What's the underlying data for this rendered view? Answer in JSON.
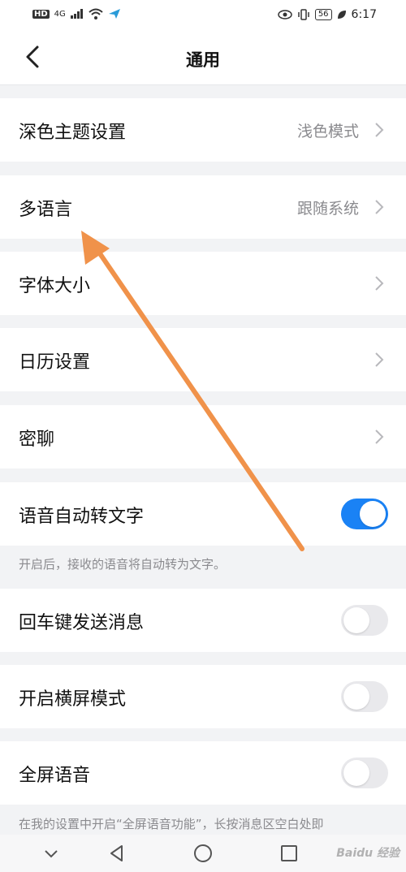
{
  "status_bar": {
    "left_badge": "HD",
    "network": "4G",
    "battery": "56",
    "time": "6:17"
  },
  "header": {
    "title": "通用"
  },
  "settings": {
    "dark_theme": {
      "label": "深色主题设置",
      "value": "浅色模式"
    },
    "language": {
      "label": "多语言",
      "value": "跟随系统"
    },
    "font_size": {
      "label": "字体大小"
    },
    "calendar": {
      "label": "日历设置"
    },
    "secret_chat": {
      "label": "密聊"
    },
    "voice_to_text": {
      "label": "语音自动转文字",
      "enabled": true
    },
    "voice_hint": "开启后，接收的语音将自动转为文字。",
    "enter_send": {
      "label": "回车键发送消息",
      "enabled": false
    },
    "landscape": {
      "label": "开启横屏模式",
      "enabled": false
    },
    "fullscreen_voice": {
      "label": "全屏语音",
      "enabled": false
    },
    "fullscreen_hint": "在我的设置中开启“全屏语音功能”，长按消息区空白处即"
  },
  "watermark": "Baidu 经验",
  "colors": {
    "accent": "#1a82f5",
    "annotation_arrow": "#f0924a"
  }
}
